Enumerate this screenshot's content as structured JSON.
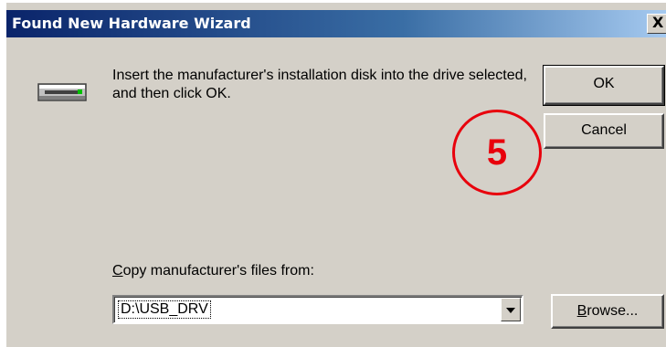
{
  "window": {
    "title": "Found New Hardware Wizard",
    "close_glyph": "X"
  },
  "dialog": {
    "icon": "drive-icon",
    "message": "Insert the manufacturer's installation disk into the drive selected, and then click OK.",
    "ok_label": "OK",
    "cancel_label": "Cancel",
    "copy_label": "Copy manufacturer's files from:",
    "path_value": "D:\\USB_DRV",
    "browse_label": "Browse..."
  },
  "annotation": {
    "step_number": "5",
    "color": "#e8000c"
  },
  "colors": {
    "titlebar_start": "#0a246a",
    "titlebar_end": "#a6caf0",
    "face": "#d4d0c8"
  }
}
